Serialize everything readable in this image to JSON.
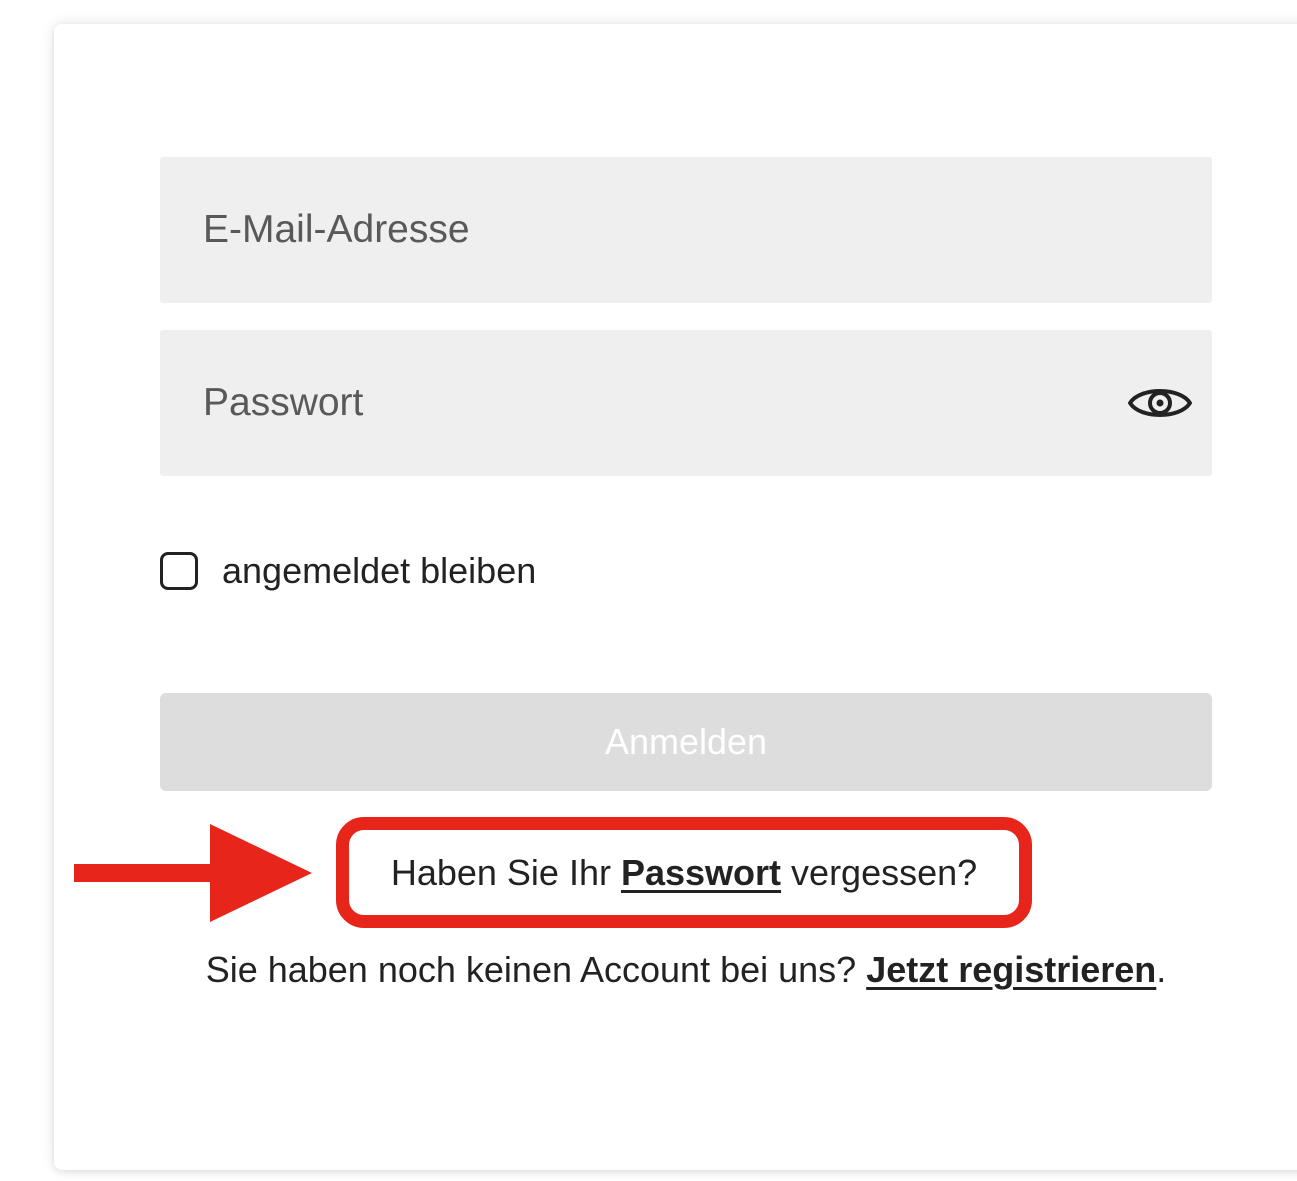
{
  "login_form": {
    "email_placeholder": "E-Mail-Adresse",
    "password_placeholder": "Passwort",
    "password_toggle_icon": "eye-icon",
    "remember_me_label": "angemeldet bleiben",
    "remember_me_checked": false,
    "submit_label": "Anmelden"
  },
  "forgot_password": {
    "prefix": "Haben Sie Ihr ",
    "link_label": "Passwort",
    "suffix": " vergessen?"
  },
  "register": {
    "prefix": "Sie haben noch keinen Account bei uns? ",
    "link_label": "Jetzt registrieren",
    "suffix": "."
  },
  "annotation": {
    "color": "#e8251b",
    "arrow_icon": "arrow-right-icon"
  },
  "colors": {
    "field_background": "#efefef",
    "button_disabled": "#dddddd",
    "text": "#222222"
  }
}
